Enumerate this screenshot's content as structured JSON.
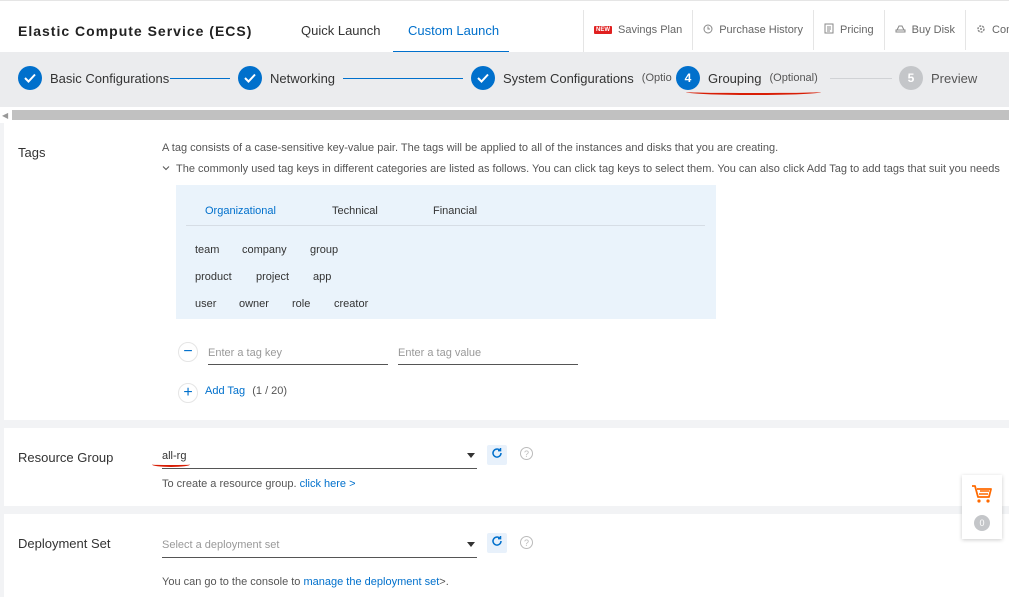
{
  "header": {
    "title": "Elastic Compute Service (ECS)",
    "tabs": [
      {
        "label": "Quick Launch"
      },
      {
        "label": "Custom Launch",
        "active": true
      }
    ],
    "links": [
      {
        "label": "Savings Plan",
        "badge": "NEW",
        "icon": "new-badge-icon"
      },
      {
        "label": "Purchase History",
        "icon": "clock-icon"
      },
      {
        "label": "Pricing",
        "icon": "document-icon"
      },
      {
        "label": "Buy Disk",
        "icon": "disk-icon"
      },
      {
        "label": "Con",
        "icon": "gear-icon"
      }
    ]
  },
  "steps": [
    {
      "number": "1",
      "label": "Basic Configurations",
      "state": "done"
    },
    {
      "number": "2",
      "label": "Networking",
      "state": "done"
    },
    {
      "number": "3",
      "label": "System Configurations",
      "suffix": "(Optio",
      "state": "done"
    },
    {
      "number": "4",
      "label": "Grouping",
      "suffix": "(Optional)",
      "state": "active"
    },
    {
      "number": "5",
      "label": "Preview",
      "state": "todo"
    }
  ],
  "tags": {
    "label": "Tags",
    "description": "A tag consists of a case-sensitive key-value pair. The tags will be applied to all of the instances and disks that you are creating.",
    "common_note": "The commonly used tag keys in different categories are listed as follows. You can click tag keys to select them. You can also click Add Tag to add tags that suit you needs",
    "categories": [
      "Organizational",
      "Technical",
      "Financial"
    ],
    "rows": [
      [
        "team",
        "company",
        "group"
      ],
      [
        "product",
        "project",
        "app"
      ],
      [
        "user",
        "owner",
        "role",
        "creator"
      ]
    ],
    "key_placeholder": "Enter a tag key",
    "value_placeholder": "Enter a tag value",
    "add_tag_label": "Add Tag",
    "count": "(1 / 20)"
  },
  "resource_group": {
    "label": "Resource Group",
    "value": "all-rg",
    "help_prefix": "To create a resource group.",
    "help_link": "click here >"
  },
  "deployment_set": {
    "label": "Deployment Set",
    "placeholder": "Select a deployment set",
    "help_prefix": "You can go to the console to",
    "help_link": "manage the deployment set",
    "help_suffix": ">."
  },
  "cart": {
    "count": "0"
  },
  "colors": {
    "accent": "#0070cc",
    "annotation": "#d81e06",
    "cart": "#ff6a00"
  }
}
